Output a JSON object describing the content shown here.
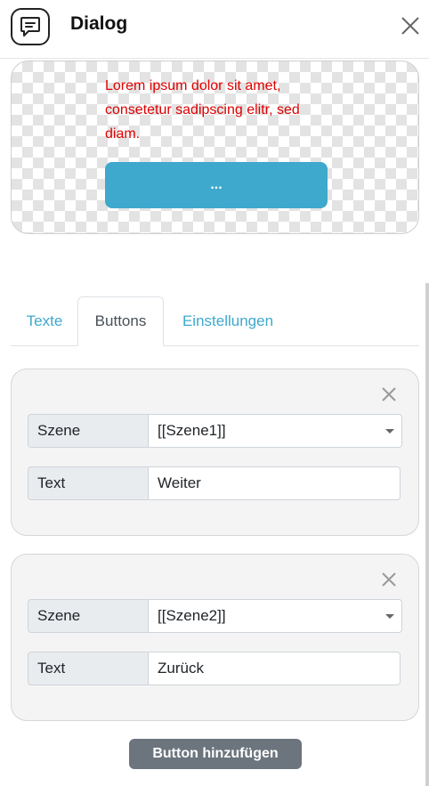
{
  "header": {
    "icon": "chat-bubble-icon",
    "title": "Dialog",
    "close_icon": "close-icon"
  },
  "preview": {
    "text": "Lorem ipsum dolor sit amet, consetetur sadipscing elitr, sed diam.",
    "button_label": "...",
    "text_color": "#e00000",
    "button_color": "#3fa8cd"
  },
  "tabs": [
    {
      "label": "Texte",
      "active": false
    },
    {
      "label": "Buttons",
      "active": true
    },
    {
      "label": "Einstellungen",
      "active": false
    }
  ],
  "buttons": [
    {
      "scene_label": "Szene",
      "scene_value": "[[Szene1]]",
      "text_label": "Text",
      "text_value": "Weiter"
    },
    {
      "scene_label": "Szene",
      "scene_value": "[[Szene2]]",
      "text_label": "Text",
      "text_value": "Zurück"
    }
  ],
  "add_button_label": "Button hinzufügen",
  "colors": {
    "accent": "#3fa8cd",
    "secondary": "#6c757d"
  }
}
